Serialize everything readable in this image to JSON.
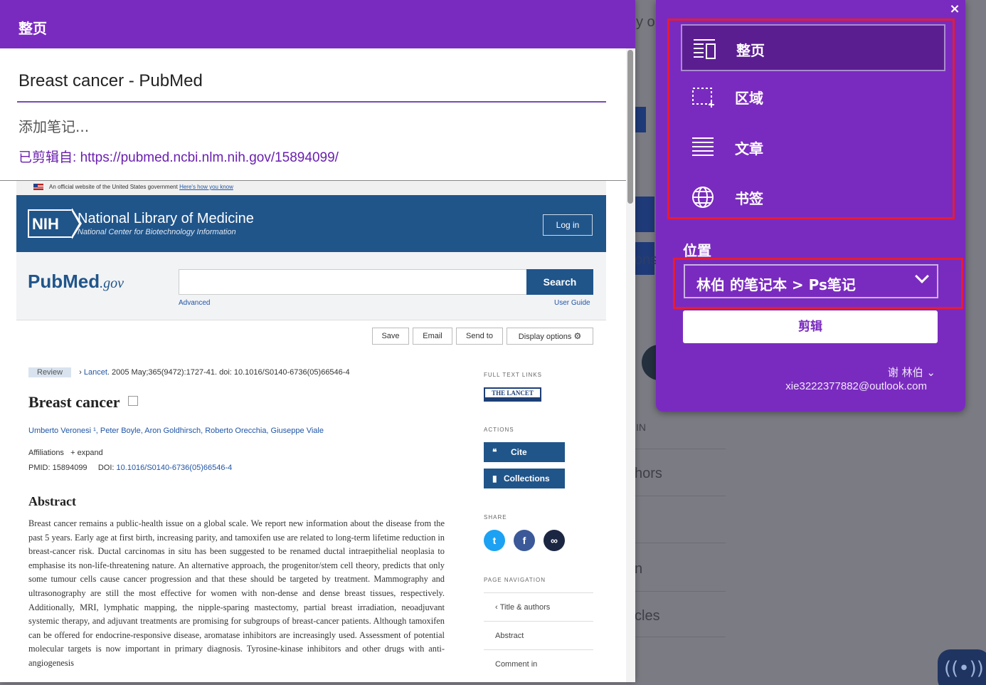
{
  "background": {
    "fragments": [
      "y op",
      "ons",
      "IN",
      "hors",
      "n",
      "cles"
    ],
    "fab_icon": "broadcast-icon"
  },
  "clipper": {
    "header_title": "整页",
    "page_title": "Breast cancer - PubMed",
    "note_placeholder": "添加笔记...",
    "source_prefix": "已剪辑自:",
    "source_url": "https://pubmed.ncbi.nlm.nih.gov/15894099/"
  },
  "pubmed": {
    "gov_banner": "An official website of the United States government",
    "gov_banner_link": "Here's how you know",
    "nih_logo": "NIH",
    "nlm_title": "National Library of Medicine",
    "nlm_subtitle": "National Center for Biotechnology Information",
    "login": "Log in",
    "logo": {
      "pub": "Pub",
      "med": "Med",
      "gov": ".gov"
    },
    "search_button": "Search",
    "advanced": "Advanced",
    "user_guide": "User Guide",
    "toolbar": [
      "Save",
      "Email",
      "Send to",
      "Display options"
    ],
    "review_badge": "Review",
    "journal": "Lancet",
    "citation": "2005 May;365(9472):1727-41. doi: 10.1016/S0140-6736(05)66546-4",
    "title": "Breast cancer",
    "authors": "Umberto Veronesi ¹, Peter Boyle, Aron Goldhirsch, Roberto Orecchia, Giuseppe Viale",
    "affiliations": "Affiliations",
    "expand": "+ expand",
    "pmid": "PMID: 15894099",
    "doi_label": "DOI:",
    "doi": "10.1016/S0140-6736(05)66546-4",
    "abstract_heading": "Abstract",
    "abstract": "Breast cancer remains a public-health issue on a global scale. We report new information about the disease from the past 5 years. Early age at first birth, increasing parity, and tamoxifen use are related to long-term lifetime reduction in breast-cancer risk. Ductal carcinomas in situ has been suggested to be renamed ductal intraepithelial neoplasia to emphasise its non-life-threatening nature. An alternative approach, the progenitor/stem cell theory, predicts that only some tumour cells cause cancer progression and that these should be targeted by treatment. Mammography and ultrasonography are still the most effective for women with non-dense and dense breast tissues, respectively. Additionally, MRI, lymphatic mapping, the nipple-sparing mastectomy, partial breast irradiation, neoadjuvant systemic therapy, and adjuvant treatments are promising for subgroups of breast-cancer patients. Although tamoxifen can be offered for endocrine-responsive disease, aromatase inhibitors are increasingly used. Assessment of potential molecular targets is now important in primary diagnosis. Tyrosine-kinase inhibitors and other drugs with anti-angiogenesis",
    "full_text_links": "FULL TEXT LINKS",
    "lancet_logo": "THE LANCET",
    "actions": "ACTIONS",
    "cite": "Cite",
    "collections": "Collections",
    "share": "SHARE",
    "page_navigation": "PAGE NAVIGATION",
    "nav": [
      "Title & authors",
      "Abstract",
      "Comment in"
    ]
  },
  "popup": {
    "close": "×",
    "modes": [
      {
        "label": "整页",
        "icon": "full-page-icon"
      },
      {
        "label": "区域",
        "icon": "region-icon"
      },
      {
        "label": "文章",
        "icon": "article-icon"
      },
      {
        "label": "书签",
        "icon": "bookmark-globe-icon"
      }
    ],
    "location_label": "位置",
    "location_value": "林伯 的笔记本 > Ps笔记",
    "clip_button": "剪辑",
    "user_name": "谢 林伯",
    "user_email": "xie3222377882@outlook.com"
  },
  "colors": {
    "accent": "#7a2bbf",
    "highlight_border": "#e51c35",
    "pubmed_blue": "#20558a"
  }
}
